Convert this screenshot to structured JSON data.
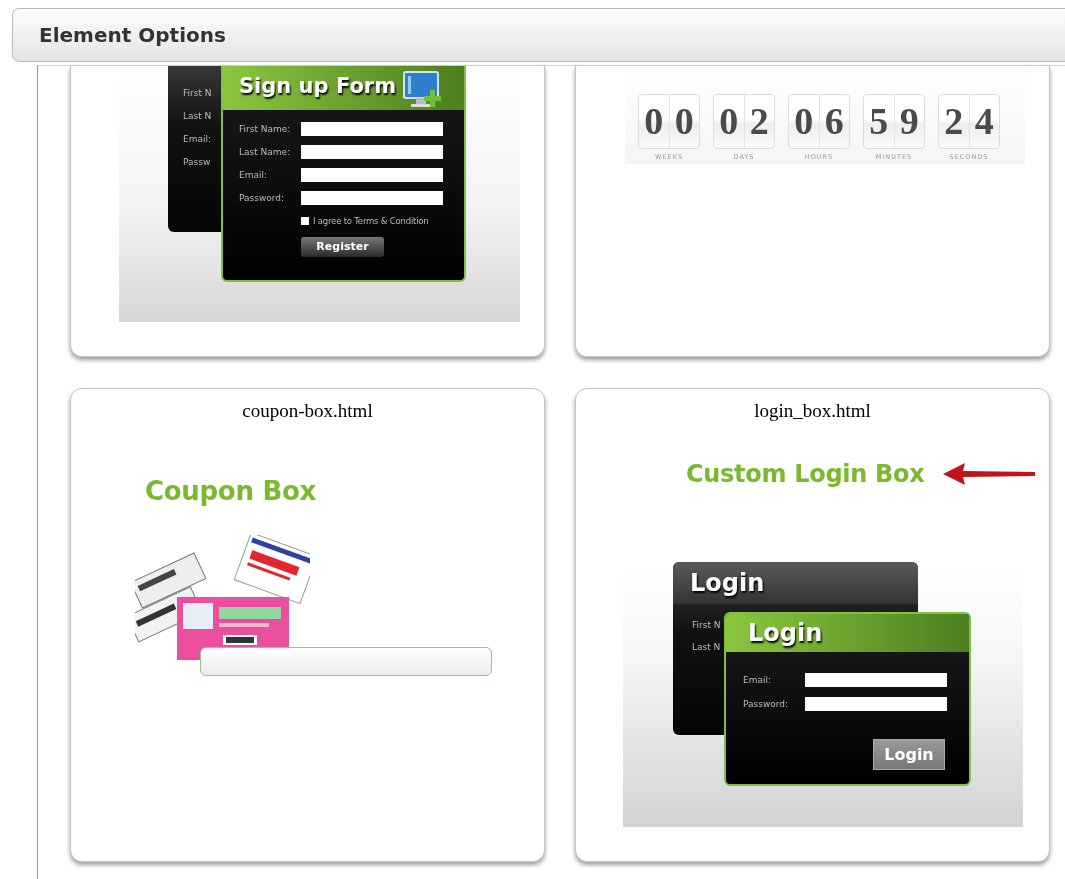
{
  "panel": {
    "title": "Element Options"
  },
  "templates": [
    {
      "kind": "signup",
      "preview": {
        "back_labels": [
          "First N",
          "Last N",
          "Email:",
          "Passw"
        ],
        "title": "Sign up Form",
        "fields": [
          {
            "label": "First Name:"
          },
          {
            "label": "Last Name:"
          },
          {
            "label": "Email:"
          },
          {
            "label": "Password:"
          }
        ],
        "agree": {
          "label": "I agree to Terms & Condition",
          "checked": false
        },
        "button": "Register"
      }
    },
    {
      "kind": "countdown",
      "preview": {
        "units": [
          {
            "digits": [
              "0",
              "0"
            ],
            "label": "WEEKS"
          },
          {
            "digits": [
              "0",
              "2"
            ],
            "label": "DAYS"
          },
          {
            "digits": [
              "0",
              "6"
            ],
            "label": "HOURS"
          },
          {
            "digits": [
              "5",
              "9"
            ],
            "label": "MINUTES"
          },
          {
            "digits": [
              "2",
              "4"
            ],
            "label": "SECONDS"
          }
        ]
      }
    },
    {
      "kind": "coupon",
      "file": "coupon-box.html",
      "heading": "Coupon Box"
    },
    {
      "kind": "login",
      "file": "login_box.html",
      "heading": "Custom Login Box",
      "preview": {
        "back_title": "Login",
        "back_labels": [
          "First N",
          "Last N"
        ],
        "title": "Login",
        "fields": [
          {
            "label": "Email:"
          },
          {
            "label": "Password:"
          }
        ],
        "button": "Login"
      }
    }
  ]
}
